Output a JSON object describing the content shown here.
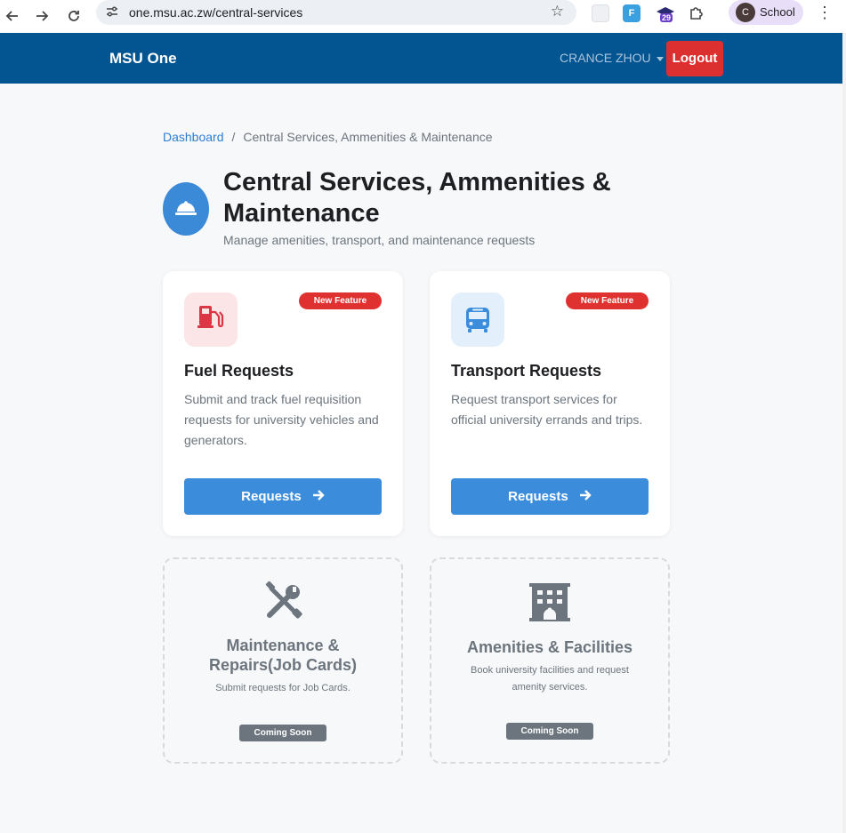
{
  "browser": {
    "url": "one.msu.ac.zw/central-services",
    "profile_initial": "C",
    "profile_name": "School",
    "ext_badge": "29"
  },
  "navbar": {
    "brand": "MSU One",
    "user": "CRANCE ZHOU",
    "logout": "Logout"
  },
  "breadcrumb": {
    "home": "Dashboard",
    "separator": "/",
    "current": "Central Services, Ammenities & Maintenance"
  },
  "header": {
    "title": "Central Services, Ammenities & Maintenance",
    "subtitle": "Manage amenities, transport, and maintenance requests",
    "icon": "concierge-bell-icon"
  },
  "cards": [
    {
      "title": "Fuel Requests",
      "badge": "New Feature",
      "description": "Submit and track fuel requisition requests for university vehicles and generators.",
      "button": "Requests",
      "icon": "gas-pump-icon",
      "icon_color": "#dc3545",
      "icon_bg": "#fbe5e6"
    },
    {
      "title": "Transport Requests",
      "badge": "New Feature",
      "description": "Request transport services for official university errands and trips.",
      "button": "Requests",
      "icon": "bus-icon",
      "icon_color": "#3b8ddb",
      "icon_bg": "#e3effb"
    }
  ],
  "coming_soon": [
    {
      "title_line1": "Maintenance &",
      "title_line2": "Repairs(Job Cards)",
      "description": "Submit requests for Job Cards.",
      "badge": "Coming Soon",
      "icon": "tools-icon"
    },
    {
      "title_line1": "Amenities & Facilities",
      "description": "Book university facilities and request amenity services.",
      "badge": "Coming Soon",
      "icon": "building-icon"
    }
  ],
  "colors": {
    "navbar": "#035591",
    "accent": "#3b8ddb",
    "danger": "#dc3030",
    "muted": "#6c757d"
  }
}
